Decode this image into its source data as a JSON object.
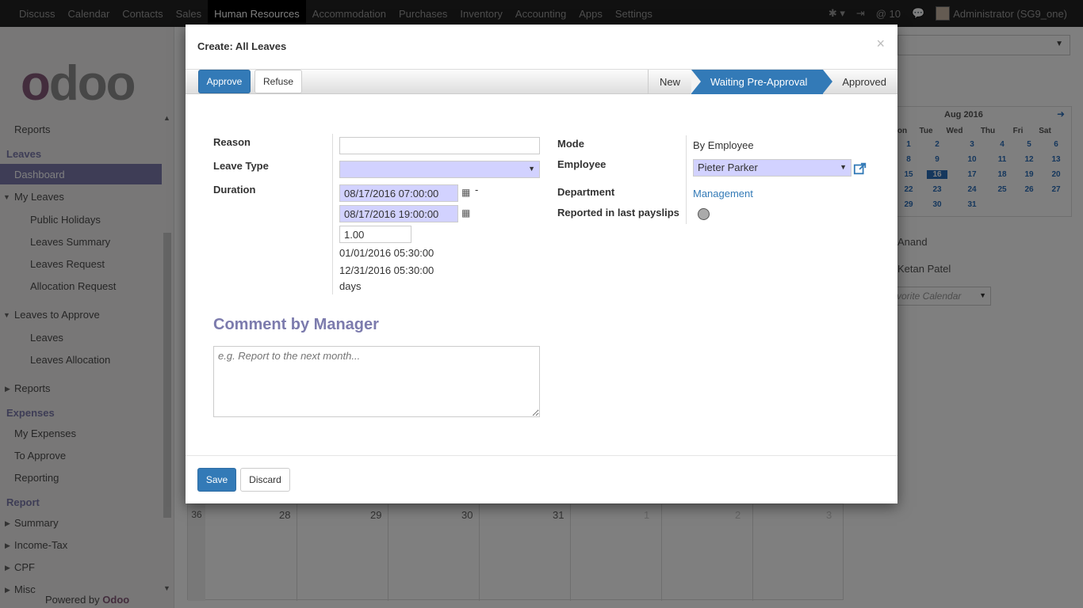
{
  "topnav": {
    "menus": [
      "Discuss",
      "Calendar",
      "Contacts",
      "Sales",
      "Human Resources",
      "Accommodation",
      "Purchases",
      "Inventory",
      "Accounting",
      "Apps",
      "Settings"
    ],
    "active_index": 4,
    "mentions": "@ 10",
    "user": "Administrator (SG9_one)"
  },
  "sidebar": {
    "logo": "odoo",
    "reports_top": "Reports",
    "leaves_head": "Leaves",
    "dashboard": "Dashboard",
    "my_leaves": "My Leaves",
    "public_holidays": "Public Holidays",
    "leaves_summary": "Leaves Summary",
    "leaves_request": "Leaves Request",
    "allocation_request": "Allocation Request",
    "leaves_to_approve": "Leaves to Approve",
    "leaves": "Leaves",
    "leaves_allocation": "Leaves Allocation",
    "reports": "Reports",
    "expenses_head": "Expenses",
    "my_expenses": "My Expenses",
    "to_approve": "To Approve",
    "reporting": "Reporting",
    "report_head": "Report",
    "summary": "Summary",
    "income_tax": "Income-Tax",
    "cpf": "CPF",
    "misc": "Misc",
    "powered_by": "Powered by",
    "powered_brand": "Odoo"
  },
  "background": {
    "mini_calendar": {
      "title": "Aug 2016",
      "weekdays": [
        "on",
        "Tue",
        "Wed",
        "Thu",
        "Fri",
        "Sat"
      ],
      "rows": [
        [
          "1",
          "2",
          "3",
          "4",
          "5",
          "6"
        ],
        [
          "8",
          "9",
          "10",
          "11",
          "12",
          "13"
        ],
        [
          "15",
          "16",
          "17",
          "18",
          "19",
          "20"
        ],
        [
          "22",
          "23",
          "24",
          "25",
          "26",
          "27"
        ],
        [
          "29",
          "30",
          "31",
          "",
          "",
          ""
        ]
      ],
      "today": "16"
    },
    "attendees": [
      "Anand",
      "Ketan Patel"
    ],
    "favorite_calendar": "vorite Calendar",
    "week_number": "36",
    "week_days": [
      "28",
      "29",
      "30",
      "31",
      "1",
      "2",
      "3"
    ]
  },
  "modal": {
    "title": "Create: All Leaves",
    "close": "×",
    "approve": "Approve",
    "refuse": "Refuse",
    "stages": [
      "New",
      "Waiting Pre-Approval",
      "Approved"
    ],
    "active_stage": 1,
    "form": {
      "reason_label": "Reason",
      "reason_value": "",
      "leave_type_label": "Leave Type",
      "leave_type_value": "",
      "duration_label": "Duration",
      "date_from": "08/17/2016 07:00:00",
      "date_to": "08/17/2016 19:00:00",
      "dash": "-",
      "number_of_days": "1.00",
      "date_from_utc": "01/01/2016 05:30:00",
      "date_to_utc": "12/31/2016 05:30:00",
      "days_unit": "days",
      "mode_label": "Mode",
      "mode_value": "By Employee",
      "employee_label": "Employee",
      "employee_value": "Pieter Parker",
      "department_label": "Department",
      "department_value": "Management",
      "payslip_label": "Reported in last payslips"
    },
    "comment_title": "Comment by Manager",
    "comment_placeholder": "e.g. Report to the next month...",
    "save": "Save",
    "discard": "Discard"
  }
}
